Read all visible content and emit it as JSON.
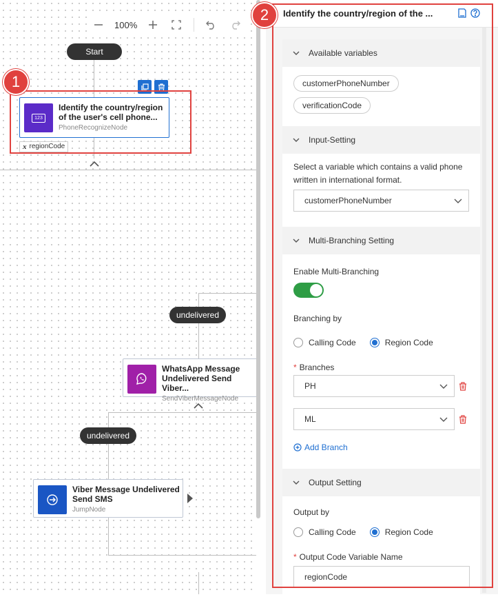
{
  "toolbar": {
    "zoom": "100%"
  },
  "flow": {
    "start_label": "Start",
    "node1": {
      "title_line1": "Identify the country/region",
      "title_line2": "of the user's cell phone...",
      "type": "PhoneRecognizeNode",
      "icon_text": "123",
      "output_var": "regionCode"
    },
    "node2": {
      "title_line1": "WhatsApp Message",
      "title_line2": "Undelivered Send Viber...",
      "type": "SendViberMessageNode"
    },
    "node3": {
      "title_line1": "Viber Message Undelivered",
      "title_line2": "Send SMS",
      "type": "JumpNode"
    },
    "edge_label_1": "undelivered",
    "edge_label_2": "undelivered"
  },
  "badges": {
    "one": "1",
    "two": "2"
  },
  "panel": {
    "title": "Identify the country/region of the ...",
    "available_variables": {
      "heading": "Available variables",
      "chips": [
        "customerPhoneNumber",
        "verificationCode"
      ]
    },
    "input_setting": {
      "heading": "Input-Setting",
      "desc_line1": "Select a variable which contains a valid phone",
      "desc_line2": "written in international format.",
      "selected": "customerPhoneNumber"
    },
    "multi_branching": {
      "heading": "Multi-Branching Setting",
      "enable_label": "Enable Multi-Branching",
      "branching_by_label": "Branching by",
      "option_calling": "Calling Code",
      "option_region": "Region Code",
      "branches_label": "Branches",
      "branches": [
        "PH",
        "ML"
      ],
      "add_branch": "Add Branch"
    },
    "output_setting": {
      "heading": "Output Setting",
      "output_by_label": "Output by",
      "option_calling": "Calling Code",
      "option_region": "Region Code",
      "var_name_label": "Output Code Variable Name",
      "var_name_value": "regionCode"
    }
  },
  "colors": {
    "accent": "#1f6fd1",
    "highlight": "#e0413e",
    "toggle_on": "#2e9d45",
    "node1_icon": "#5b2bc8",
    "node2_icon": "#a020a8",
    "node3_icon": "#1a56c4"
  }
}
